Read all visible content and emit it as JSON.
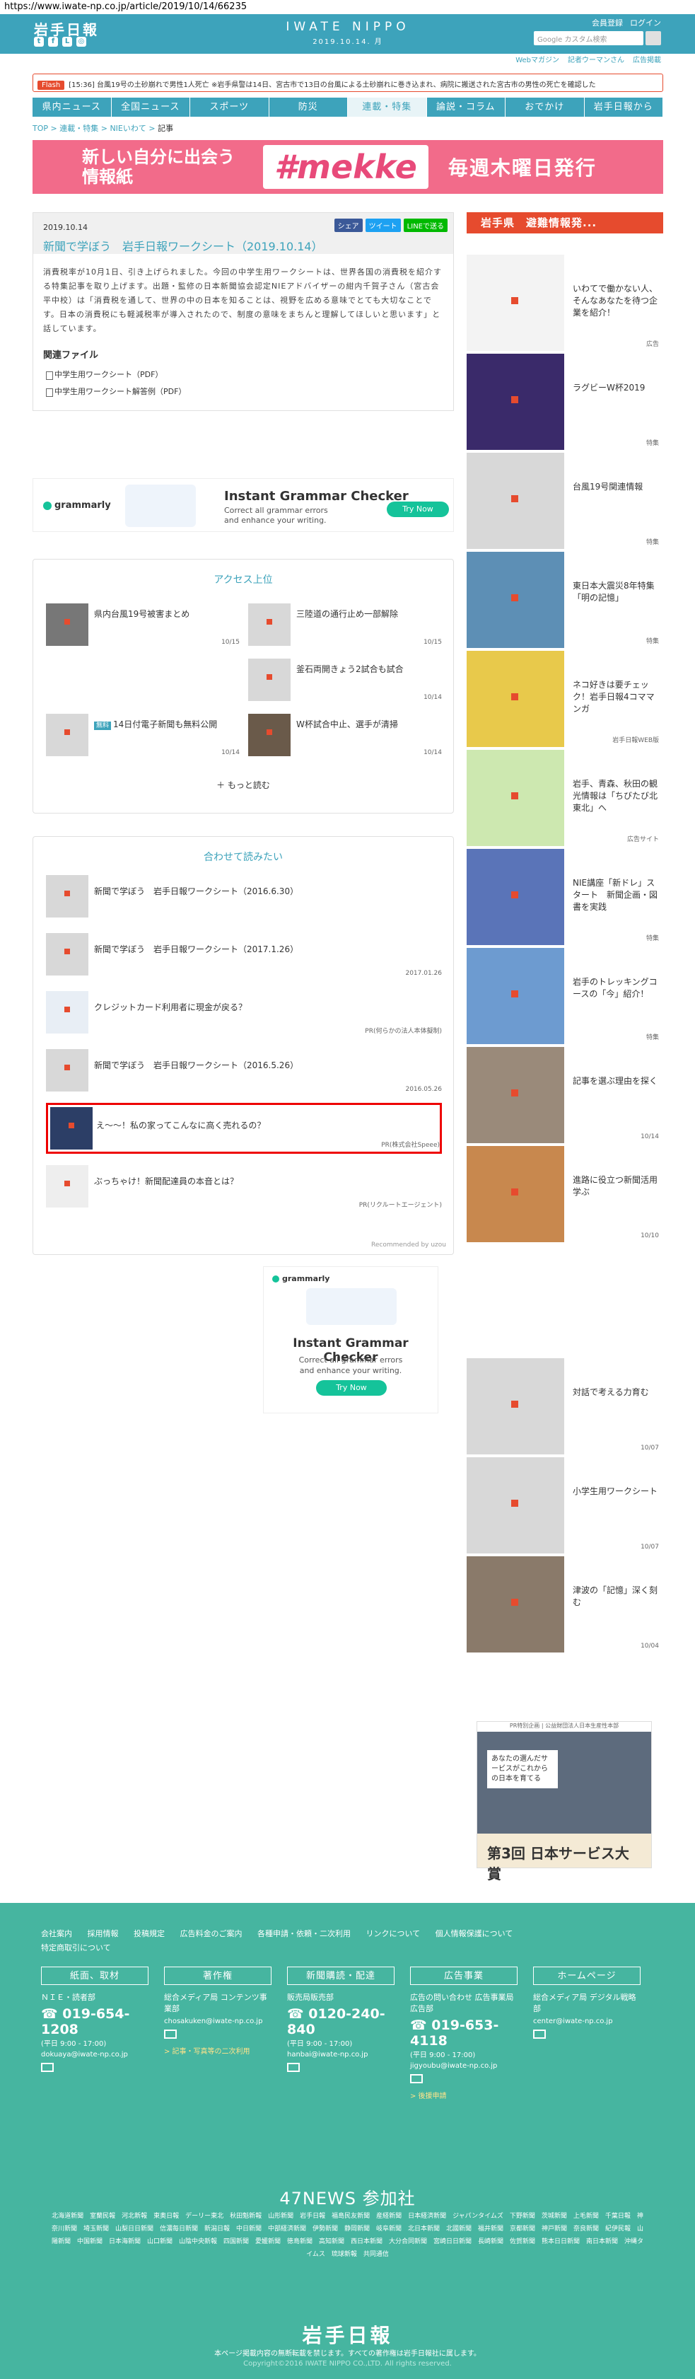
{
  "browser": {
    "url": "https://www.iwate-np.co.jp/article/2019/10/14/66235"
  },
  "header": {
    "logo": "岩手日報",
    "center_title": "IWATE NIPPO",
    "center_date": "2019.10.14. 月",
    "links": [
      "会員登録",
      "ログイン"
    ],
    "search_placeholder": "Google カスタム検索",
    "sub_links": [
      "Webマガジン",
      "記者ウーマンさん",
      "広告掲載"
    ]
  },
  "flash": {
    "tag": "Flash",
    "text": "[15:36] 台風19号の土砂崩れで男性1人死亡 ※岩手県警は14日、宮古市で13日の台風による土砂崩れに巻き込まれ、病院に搬送された宮古市の男性の死亡を確認した"
  },
  "nav": {
    "items": [
      "県内ニュース",
      "全国ニュース",
      "スポーツ",
      "防災",
      "連載・特集",
      "論説・コラム",
      "おでかけ",
      "岩手日報から"
    ],
    "active": "連載・特集"
  },
  "breadcrumb": {
    "items": [
      "TOP",
      "連載・特集",
      "NIEいわて"
    ],
    "current": "記事"
  },
  "banner": {
    "line1": "新しい自分に出会う",
    "line2": "情報紙",
    "brand": "#mekke",
    "tail": "毎週木曜日発行"
  },
  "article": {
    "date": "2019.10.14",
    "title": "新聞で学ぼう　岩手日報ワークシート（2019.10.14）",
    "share": [
      "シェア",
      "ツイート",
      "LINEで送る"
    ],
    "body": "消費税率が10月1日、引き上げられました。今回の中学生用ワークシートは、世界各国の消費税を紹介する特集記事を取り上げます。出題・監修の日本新聞協会認定NIEアドバイザーの紺内千賀子さん（宮古会平中校）は「消費税を通して、世界の中の日本を知ることは、視野を広める意味でとても大切なことです。日本の消費税にも軽減税率が導入されたので、制度の意味をまちんと理解してほしいと思います」と話しています。",
    "files_heading": "関連ファイル",
    "files": [
      "中学生用ワークシート（PDF）",
      "中学生用ワークシート解答例（PDF）"
    ]
  },
  "ad1": {
    "brand": "grammarly",
    "headline": "Instant Grammar Checker",
    "sub1": "Correct all grammar errors",
    "sub2": "and enhance your writing.",
    "cta": "Try Now"
  },
  "access": {
    "title": "アクセス上位",
    "items": [
      {
        "text": "県内台風19号被害まとめ",
        "date": "10/15"
      },
      {
        "text": "三陸道の通行止め一部解除",
        "date": "10/15"
      },
      {
        "text": "釜石両開きょう2試合も試合",
        "date": "10/14"
      },
      {
        "tag": "無料",
        "text": "14日付電子新聞も無料公開",
        "date": "10/14"
      },
      {
        "text": "W杯試合中止、選手が清掃",
        "date": "10/14"
      }
    ],
    "more": "もっと読む"
  },
  "related": {
    "title": "合わせて読みたい",
    "items": [
      {
        "text": "新聞で学ぼう　岩手日報ワークシート（2016.6.30）",
        "src": ""
      },
      {
        "text": "新聞で学ぼう　岩手日報ワークシート（2017.1.26）",
        "src": "2017.01.26"
      },
      {
        "text": "クレジットカード利用者に現金が戻る？",
        "src": "PR(何らかの法人本体擬制)"
      },
      {
        "text": "新聞で学ぼう　岩手日報ワークシート（2016.5.26）",
        "src": "2016.05.26"
      },
      {
        "text": "え〜〜！私の家ってこんなに高く売れるの？",
        "src": "PR(株式会社Speee)"
      },
      {
        "text": "ぶっちゃけ！新聞配達員の本音とは？",
        "src": "PR(リクルートエージェント)"
      }
    ],
    "recommended": "Recommended by uzou"
  },
  "ad2": {
    "brand": "grammarly",
    "headline": "Instant Grammar Checker",
    "sub1": "Correct all grammar errors",
    "sub2": "and enhance your writing.",
    "cta": "Try Now"
  },
  "sidebar": {
    "heading": "岩手県　避難情報発...",
    "items": [
      {
        "text": "いわてで働かない人、そんなあなたを待つ企業を紹介！",
        "label": "広告"
      },
      {
        "text": "ラグビーW杯2019",
        "label": "特集"
      },
      {
        "text": "台風19号関連情報",
        "label": "特集"
      },
      {
        "text": "東日本大震災8年特集「明の記憶」",
        "label": "特集"
      },
      {
        "text": "ネコ好きは要チェック！岩手日報4コママンガ",
        "label": "岩手日報WEB版"
      },
      {
        "text": "岩手、青森、秋田の観光情報は「ちびたび北東北」へ",
        "label": "広告サイト"
      },
      {
        "text": "NIE講座「新ドレ」スタート　新聞企画・図書を実践",
        "label": "特集"
      },
      {
        "text": "岩手のトレッキングコースの「今」紹介！",
        "label": "特集"
      },
      {
        "text": "記事を選ぶ理由を探く",
        "label": "10/14"
      },
      {
        "text": "進路に役立つ新聞活用学ぶ",
        "label": "10/10"
      },
      {
        "text": "対話で考える力育む",
        "label": "10/07"
      },
      {
        "text": "小学生用ワークシート",
        "label": "10/07"
      },
      {
        "text": "津波の「記憶」深く刻む",
        "label": "10/04"
      }
    ]
  },
  "pr_ad": {
    "top": "PR特別企画 | 公益財団法人日本生産性本部",
    "message": "あなたの選んだサービスがこれからの日本を育てる",
    "bottom": "第3回 日本サービス大賞"
  },
  "footer": {
    "links": [
      "会社案内",
      "採用情報",
      "投稿規定",
      "広告料金のご案内",
      "各種申請・依頼・二次利用",
      "リンクについて",
      "個人情報保護について",
      "特定商取引について"
    ],
    "cols": [
      {
        "head": "紙面、取材",
        "t": "ＮＩＥ・読者部",
        "tel": "019-654-1208",
        "hours": "(平日 9:00 - 17:00)",
        "mail": "dokuaya@iwate-np.co.jp",
        "link": ""
      },
      {
        "head": "著作権",
        "t": "総合メディア局 コンテンツ事業部",
        "tel": "",
        "hours": "",
        "mail": "chosakuken@iwate-np.co.jp",
        "link": "> 記事・写真等の二次利用"
      },
      {
        "head": "新聞購読・配達",
        "t": "販売局販売部",
        "tel": "0120-240-840",
        "hours": "(平日 9:00 - 17:00)",
        "mail": "hanbai@iwate-np.co.jp",
        "link": ""
      },
      {
        "head": "広告事業",
        "t": "広告の問い合わせ 広告事業局広告部",
        "tel": "019-653-4118",
        "hours": "(平日 9:00 - 17:00)",
        "mail": "jigyoubu@iwate-np.co.jp",
        "link": "> 後援申請"
      },
      {
        "head": "ホームページ",
        "t": "総合メディア局 デジタル戦略部",
        "tel": "",
        "hours": "",
        "mail": "center@iwate-np.co.jp",
        "link": ""
      }
    ],
    "news47_title": "47NEWS 参加社",
    "papers": "北海道新聞　室蘭民報　河北新報　東奥日報　デーリー東北　秋田魁新報　山形新聞　岩手日報　福島民友新聞　産経新聞　日本経済新聞　ジャパンタイムズ　下野新聞　茨城新聞　上毛新聞　千葉日報　神奈川新聞　埼玉新聞　山梨日日新聞　信濃毎日新聞　新潟日報　中日新聞　中部経済新聞　伊勢新聞　静岡新聞　岐阜新聞　北日本新聞　北國新聞　福井新聞　京都新聞　神戸新聞　奈良新聞　紀伊民報　山陽新聞　中国新聞　日本海新聞　山口新聞　山陰中央新報　四国新聞　愛媛新聞　徳島新聞　高知新聞　西日本新聞　大分合同新聞　宮崎日日新聞　長崎新聞　佐賀新聞　熊本日日新聞　南日本新聞　沖縄タイムス　琉球新報　共同通信",
    "logo": "岩手日報",
    "note": "本ページ掲載内容の無断転載を禁じます。すべての著作権は岩手日報社に属します。",
    "copyright": "Copyright©2016 IWATE NIPPO CO.,LTD. All rights reserved."
  }
}
